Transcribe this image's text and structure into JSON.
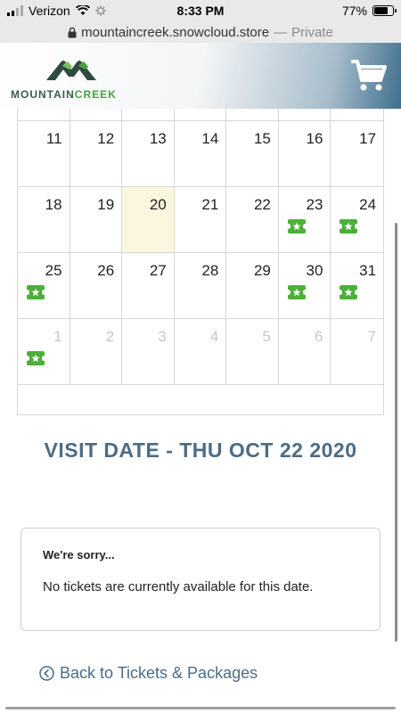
{
  "status": {
    "carrier": "Verizon",
    "time": "8:33 PM",
    "battery": "77%",
    "battery_level": 0.77
  },
  "browser": {
    "url": "mountaincreek.snowcloud.store",
    "separator": "—",
    "mode": "Private"
  },
  "header": {
    "logo_text_a": "MOUNTAIN",
    "logo_text_b": "CREEK",
    "cart_icon": "shopping-cart-icon"
  },
  "calendar": {
    "weeks": [
      [
        {
          "d": ""
        },
        {
          "d": ""
        },
        {
          "d": ""
        },
        {
          "d": ""
        },
        {
          "d": ""
        },
        {
          "d": ""
        },
        {
          "d": ""
        }
      ],
      [
        {
          "d": "11"
        },
        {
          "d": "12"
        },
        {
          "d": "13"
        },
        {
          "d": "14"
        },
        {
          "d": "15"
        },
        {
          "d": "16"
        },
        {
          "d": "17"
        }
      ],
      [
        {
          "d": "18"
        },
        {
          "d": "19"
        },
        {
          "d": "20",
          "today": true
        },
        {
          "d": "21"
        },
        {
          "d": "22"
        },
        {
          "d": "23",
          "ticket": true
        },
        {
          "d": "24",
          "ticket": true
        }
      ],
      [
        {
          "d": "25",
          "ticket": true
        },
        {
          "d": "26"
        },
        {
          "d": "27"
        },
        {
          "d": "28"
        },
        {
          "d": "29"
        },
        {
          "d": "30",
          "ticket": true
        },
        {
          "d": "31",
          "ticket": true
        }
      ],
      [
        {
          "d": "1",
          "other": true,
          "ticket": true
        },
        {
          "d": "2",
          "other": true
        },
        {
          "d": "3",
          "other": true
        },
        {
          "d": "4",
          "other": true
        },
        {
          "d": "5",
          "other": true
        },
        {
          "d": "6",
          "other": true
        },
        {
          "d": "7",
          "other": true
        }
      ]
    ],
    "ticket_color": "#4caf3a",
    "today_color": "#fbf7df"
  },
  "visit": {
    "title": "VISIT DATE - THU OCT 22 2020"
  },
  "notice": {
    "title": "We're sorry...",
    "message": "No tickets are currently available for this date."
  },
  "back": {
    "label": "Back to Tickets & Packages"
  },
  "colors": {
    "accent": "#4d6c84",
    "brand_green": "#4aa04a"
  }
}
